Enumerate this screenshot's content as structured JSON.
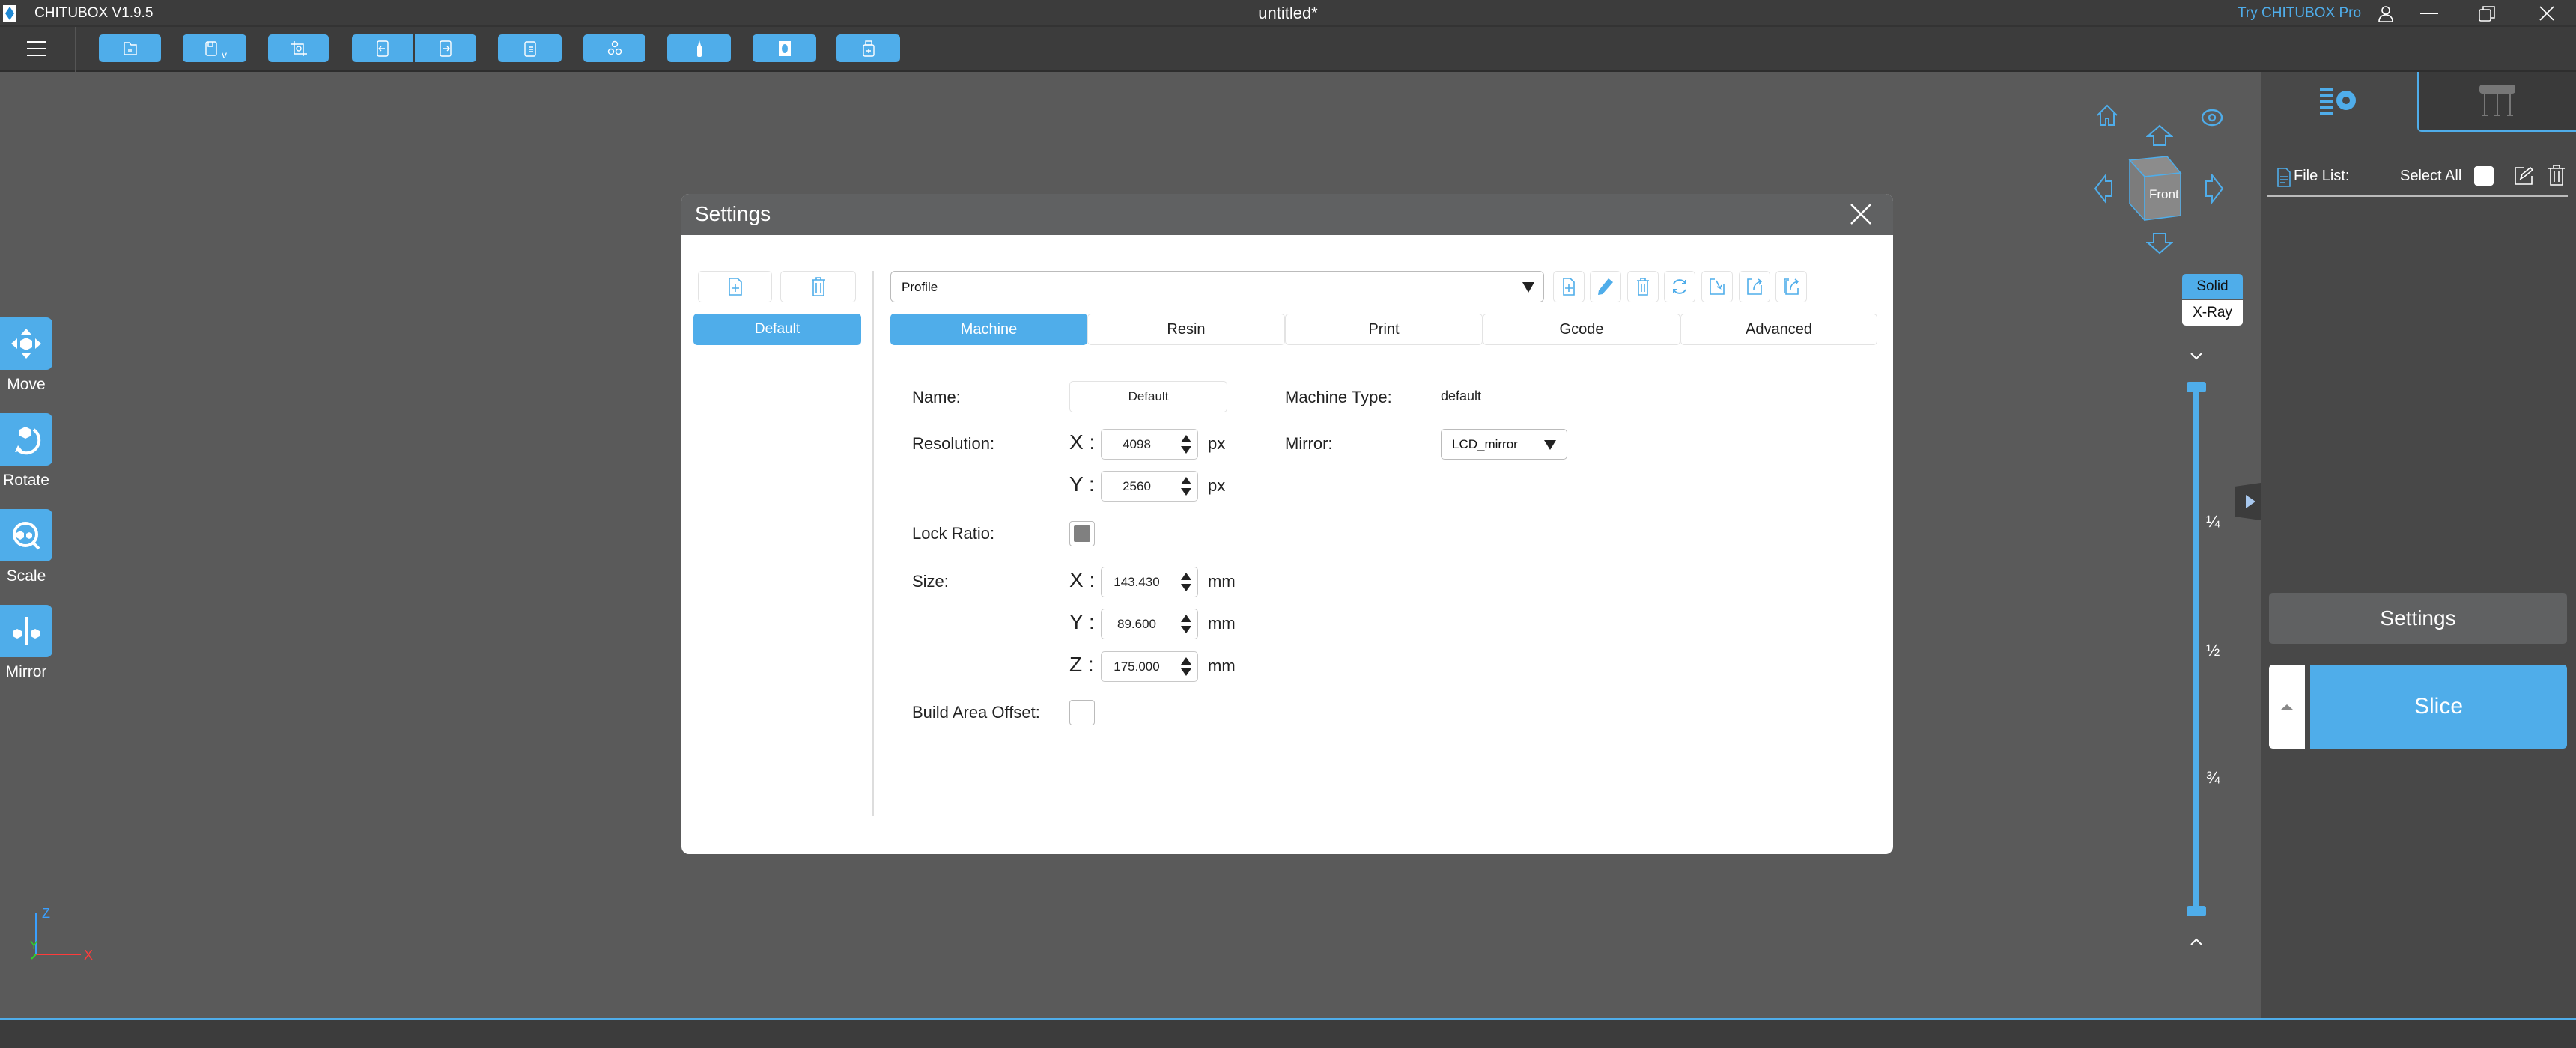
{
  "app": {
    "title": "CHITUBOX V1.9.5",
    "document": "untitled*",
    "pro_link": "Try CHITUBOX Pro"
  },
  "colors": {
    "accent": "#4fadea",
    "titlebar": "#3c3c3c",
    "viewport": "#5a5a5a",
    "panel": "#484848"
  },
  "toolbar": {
    "icons": [
      "open-file-icon",
      "save-icon",
      "auto-layout-icon",
      "undo-icon",
      "redo-icon",
      "file-list-icon",
      "duplicate-icon",
      "support-icon",
      "hollow-icon",
      "export-icon"
    ]
  },
  "left_tools": [
    {
      "label": "Move",
      "icon": "move-icon"
    },
    {
      "label": "Rotate",
      "icon": "rotate-icon"
    },
    {
      "label": "Scale",
      "icon": "scale-icon"
    },
    {
      "label": "Mirror",
      "icon": "mirror-icon"
    }
  ],
  "view": {
    "cube_front": "Front",
    "modes": [
      "Solid",
      "X-Ray"
    ],
    "active_mode": "Solid",
    "slider_marks": [
      "¼",
      "½",
      "¾"
    ]
  },
  "right_panel": {
    "file_list_label": "File List:",
    "select_all_label": "Select All",
    "settings_button": "Settings",
    "slice_button": "Slice"
  },
  "dialog": {
    "title": "Settings",
    "profiles": [
      "Default"
    ],
    "profile_select": "Profile",
    "tabs": [
      "Machine",
      "Resin",
      "Print",
      "Gcode",
      "Advanced"
    ],
    "active_tab": "Machine",
    "machine": {
      "name_label": "Name:",
      "name_value": "Default",
      "machine_type_label": "Machine Type:",
      "machine_type_value": "default",
      "resolution_label": "Resolution:",
      "res_x": "4098",
      "res_y": "2560",
      "res_unit": "px",
      "mirror_label": "Mirror:",
      "mirror_value": "LCD_mirror",
      "lock_ratio_label": "Lock Ratio:",
      "lock_ratio_checked": true,
      "size_label": "Size:",
      "size_x": "143.430",
      "size_y": "89.600",
      "size_z": "175.000",
      "size_unit": "mm",
      "build_area_offset_label": "Build Area Offset:",
      "build_area_offset_checked": false,
      "x_label": "X :",
      "y_label": "Y :",
      "z_label": "Z :"
    }
  }
}
